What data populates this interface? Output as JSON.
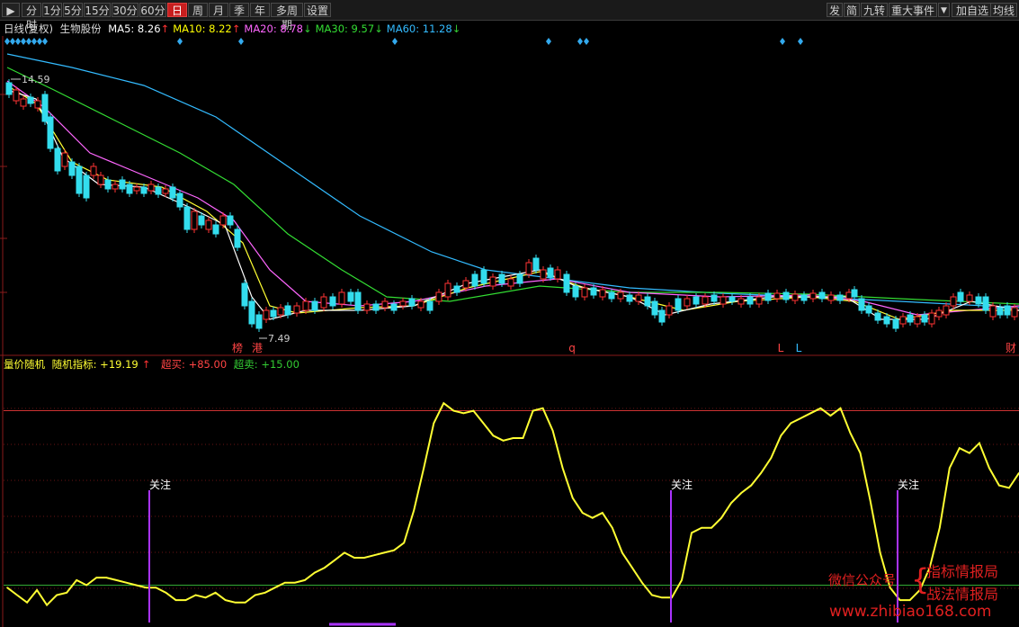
{
  "toolbar": {
    "left_buttons": [
      "分时",
      "1分",
      "5分",
      "15分",
      "30分",
      "60分",
      "日",
      "周",
      "月",
      "季",
      "年",
      "多周期",
      "设置"
    ],
    "active": "日",
    "right_buttons": [
      "发",
      "简",
      "九转",
      "重大事件",
      "加自选",
      "均线"
    ],
    "dropdown_icon": "caret-down-icon",
    "left_icon": "play-back-icon"
  },
  "info": {
    "period": "日线(复权)",
    "stock": "生物股份",
    "ma": [
      {
        "label": "MA5: 8.26",
        "arrow": "↑",
        "color": "#ffffff"
      },
      {
        "label": "MA10: 8.22",
        "arrow": "↑",
        "color": "#ffff00"
      },
      {
        "label": "MA20: 8.78",
        "arrow": "↓",
        "color": "#ff66ff"
      },
      {
        "label": "MA30: 9.57",
        "arrow": "↓",
        "color": "#33dd33"
      },
      {
        "label": "MA60: 11.28",
        "arrow": "↓",
        "color": "#33bbff"
      }
    ]
  },
  "price_chart": {
    "high_label": "14.59",
    "low_label": "7.49",
    "markers": [
      {
        "text": "榜",
        "color": "#ff4444"
      },
      {
        "text": "港",
        "color": "#ff4444"
      },
      {
        "text": "q",
        "color": "#ff4444"
      },
      {
        "text": "L",
        "color": "#ff4444"
      },
      {
        "text": "L",
        "color": "#33bbff"
      },
      {
        "text": "财",
        "color": "#ff4444"
      }
    ]
  },
  "indicator": {
    "name": "量价随机",
    "main_label": "随机指标: +19.19",
    "main_arrow": "↑",
    "overbought_label": "超买: +85.00",
    "oversold_label": "超卖: +15.00",
    "signal_label": "关注"
  },
  "chart_data": {
    "type": "line",
    "title": "量价随机",
    "series": [
      {
        "name": "随机指标",
        "color": "#ffff33",
        "values": [
          14,
          11,
          8,
          13,
          7,
          11,
          12,
          17,
          15,
          18,
          18,
          17,
          16,
          15,
          14,
          14,
          12,
          9,
          9,
          11,
          10,
          12,
          9,
          8,
          8,
          11,
          12,
          14,
          16,
          16,
          17,
          20,
          22,
          25,
          28,
          26,
          26,
          27,
          28,
          29,
          32,
          45,
          62,
          80,
          88,
          85,
          84,
          85,
          80,
          75,
          73,
          74,
          74,
          85,
          86,
          77,
          62,
          50,
          44,
          42,
          44,
          38,
          28,
          22,
          16,
          11,
          10,
          10,
          17,
          36,
          38,
          38,
          42,
          48,
          52,
          55,
          60,
          66,
          75,
          80,
          82,
          84,
          86,
          83,
          86,
          76,
          68,
          49,
          28,
          14,
          9,
          9,
          13,
          22,
          38,
          62,
          70,
          68,
          72,
          62,
          55,
          54,
          60
        ]
      },
      {
        "name": "超买",
        "color": "#cc3333",
        "values": [
          85
        ]
      },
      {
        "name": "超卖",
        "color": "#33aa33",
        "values": [
          15
        ]
      }
    ],
    "ylim": [
      0,
      100
    ]
  },
  "watermark": {
    "wechat": "微信公众号",
    "line1": "指标情报局",
    "line2": "战法情报局",
    "url": "www.zhibiao168.com"
  }
}
